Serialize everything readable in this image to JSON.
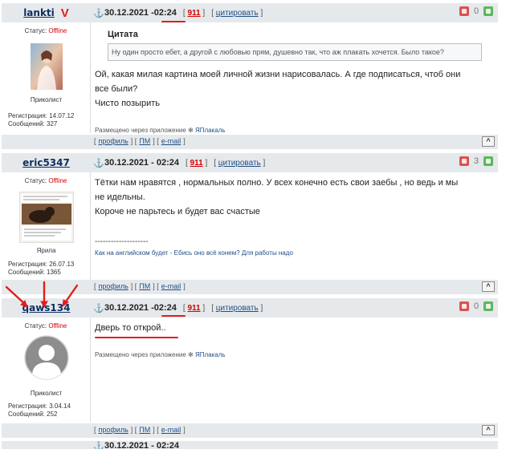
{
  "posts": [
    {
      "username": "lankti",
      "date": "30.12.2021 - ",
      "time": "02:24",
      "num": "911",
      "quote_label": "цитировать",
      "votes_down": "",
      "votes_count": "0",
      "status_label": "Статус: ",
      "status_value": "Offline",
      "rank": "Приколист",
      "reg": "Регистрация: 14.07.12",
      "msgs": "Сообщений: 327",
      "quote_title": "Цитата",
      "quote_text": "Ну один просто ебет, а другой с любовью прям, душевно так, что аж плакать хочется. Было такое?",
      "lines": [
        "Ой, какая милая картина моей личной жизни нарисовалась. А где подписаться, чтоб они",
        "все были?",
        "Чисто позырить"
      ],
      "via": "Размещено через приложение ",
      "via_app": "ЯПлакаль",
      "foot": {
        "profile": "профиль",
        "pm": "ПМ",
        "email": "e-mail"
      },
      "v_mark": "V"
    },
    {
      "username": "eric5347",
      "date": "30.12.2021 - 02:24",
      "num": "911",
      "quote_label": "цитировать",
      "votes_count": "3",
      "status_label": "Статус: ",
      "status_value": "Offline",
      "rank": "Ярила",
      "reg": "Регистрация: 26.07.13",
      "msgs": "Сообщений: 1365",
      "lines": [
        "Тётки нам нравятся , нормальных полно. У всех конечно есть свои заебы , но ведь и мы",
        "не идельны.",
        "Короче не парьтесь и будет вас счастые"
      ],
      "sig_dash": "--------------------",
      "sig": "Как на английском будет - Ебись оно всё конем? Для работы надо",
      "foot": {
        "profile": "профиль",
        "pm": "ПМ",
        "email": "e-mail"
      }
    },
    {
      "username": "qaws134",
      "date": "30.12.2021 - ",
      "time": "02:24",
      "num": "911",
      "quote_label": "цитировать",
      "votes_count": "0",
      "status_label": "Статус: ",
      "status_value": "Offline",
      "rank": "Приколист",
      "reg": "Регистрация: 3.04.14",
      "msgs": "Сообщений: 252",
      "lines": [
        "Дверь то открой.."
      ],
      "via": "Размещено через приложение ",
      "via_app": "ЯПлакаль",
      "foot": {
        "profile": "профиль",
        "pm": "ПМ",
        "email": "e-mail"
      }
    }
  ],
  "totop": "^",
  "next_date": "30.12.2021 - 02:24",
  "colors": {
    "accent": "#d40000",
    "header_bg": "#e6e9ec",
    "link": "#1f4f86",
    "annotation": "#e21d1d"
  }
}
